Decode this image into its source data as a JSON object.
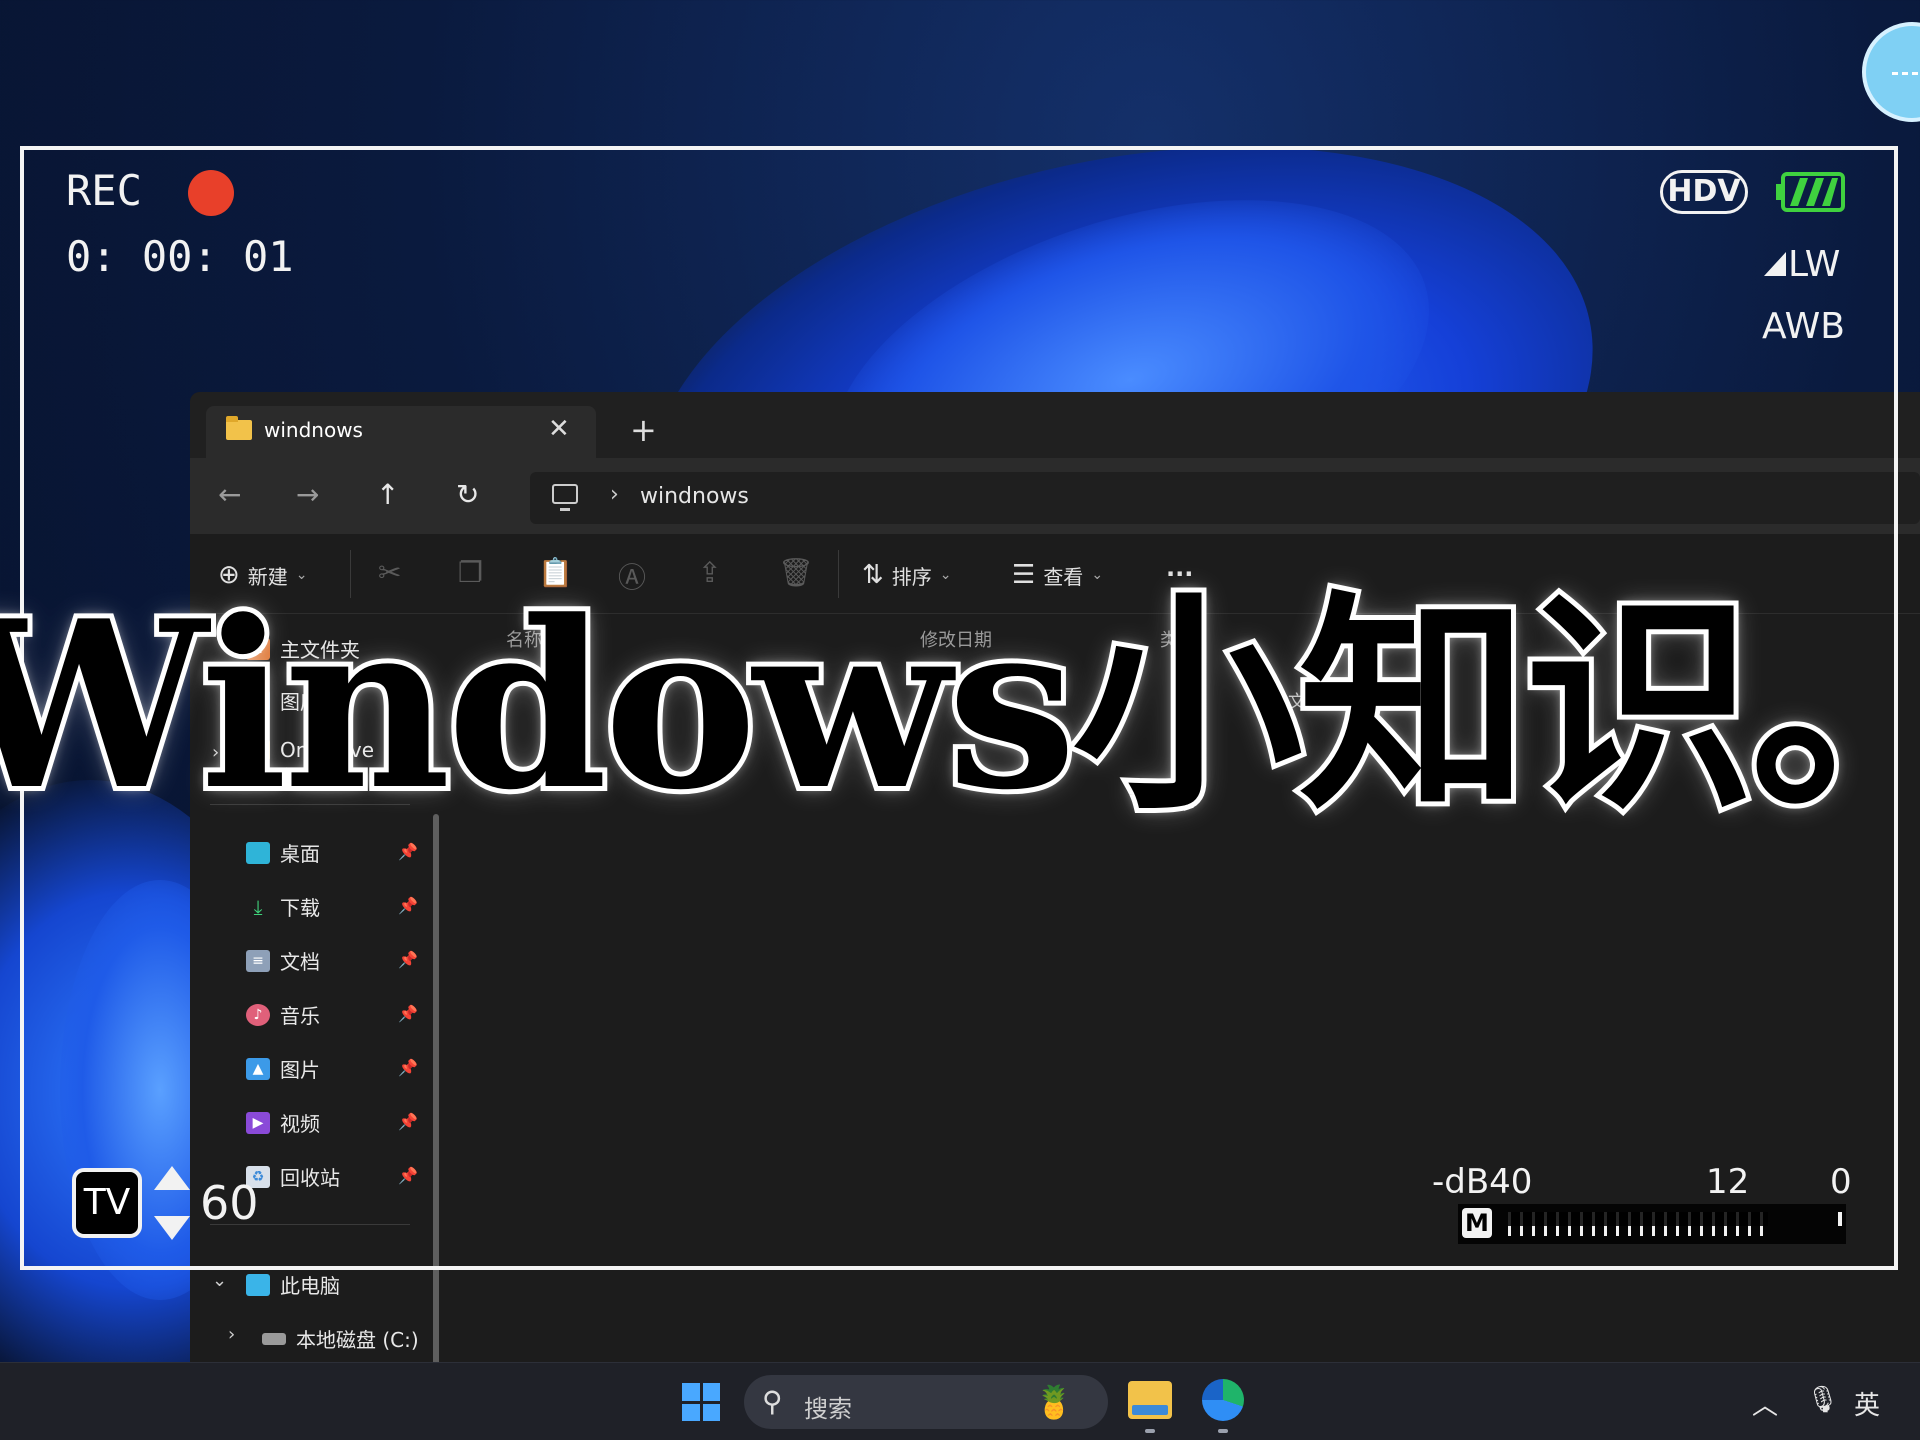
{
  "camera_overlay": {
    "rec_label": "REC",
    "timecode": "0: 00: 01",
    "hdv_label": "HDV",
    "lw_label": "LW",
    "awb_label": "AWB",
    "tv_label": "TV",
    "tv_value": "60",
    "db_label": "-dB40",
    "db_mid": "12",
    "db_end": "0",
    "meter_badge": "M",
    "rec_color": "#e8402a",
    "battery_color": "#3fd13f"
  },
  "overlay_title": "Windows小知识。",
  "explorer": {
    "tab_title": "windnows",
    "address_path": "windnows",
    "toolbar": {
      "new_label": "新建",
      "sort_label": "排序",
      "view_label": "查看",
      "more_label": "···"
    },
    "columns": {
      "name": "名称",
      "date": "修改日期",
      "type": "类型"
    },
    "empty_message": "此文件夹为空。",
    "sidebar": {
      "top": [
        {
          "label": "主文件夹"
        },
        {
          "label": "图库"
        },
        {
          "label": "OneDrive"
        }
      ],
      "pinned": [
        {
          "label": "桌面"
        },
        {
          "label": "下载"
        },
        {
          "label": "文档"
        },
        {
          "label": "音乐"
        },
        {
          "label": "图片"
        },
        {
          "label": "视频"
        },
        {
          "label": "回收站"
        }
      ],
      "this_pc": "此电脑",
      "drive": "本地磁盘 (C:)"
    }
  },
  "taskbar": {
    "search_placeholder": "搜索",
    "ime_label": "英",
    "accent": "#49a8ff"
  }
}
